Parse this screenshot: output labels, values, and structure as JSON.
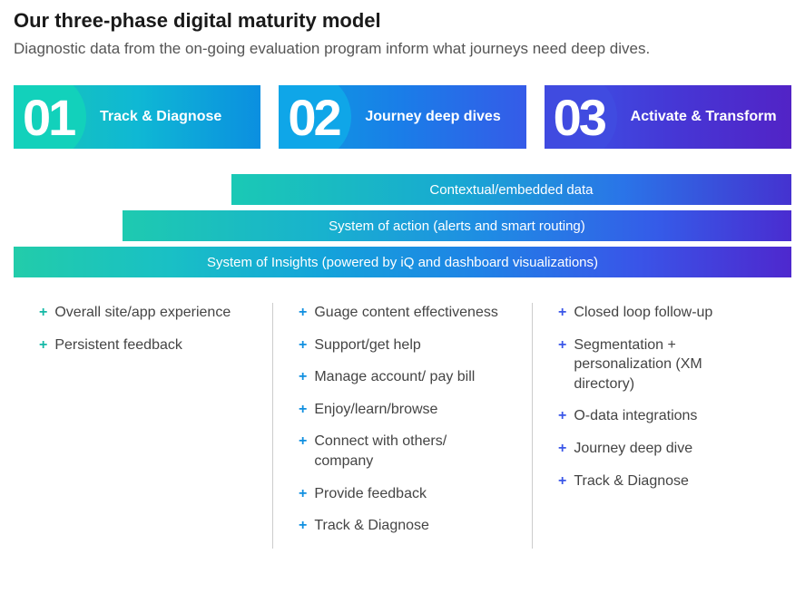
{
  "header": {
    "title": "Our three-phase digital maturity model",
    "subtitle": "Diagnostic data from the on-going evaluation program inform what journeys need deep dives."
  },
  "phases": [
    {
      "number": "01",
      "label": "Track & Diagnose"
    },
    {
      "number": "02",
      "label": "Journey deep dives"
    },
    {
      "number": "03",
      "label": "Activate & Transform"
    }
  ],
  "bars": [
    "Contextual/embedded data",
    "System of action (alerts and smart routing)",
    "System of Insights (powered by iQ and dashboard visualizations)"
  ],
  "columns": [
    [
      "Overall site/app experience",
      "Persistent feedback"
    ],
    [
      "Guage content effectiveness",
      "Support/get help",
      "Manage account/ pay bill",
      "Enjoy/learn/browse",
      "Connect with others/ company",
      "Provide feedback",
      "Track & Diagnose"
    ],
    [
      "Closed loop follow-up",
      "Segmentation + personalization (XM directory)",
      "O-data integrations",
      "Journey deep dive",
      "Track & Diagnose"
    ]
  ]
}
